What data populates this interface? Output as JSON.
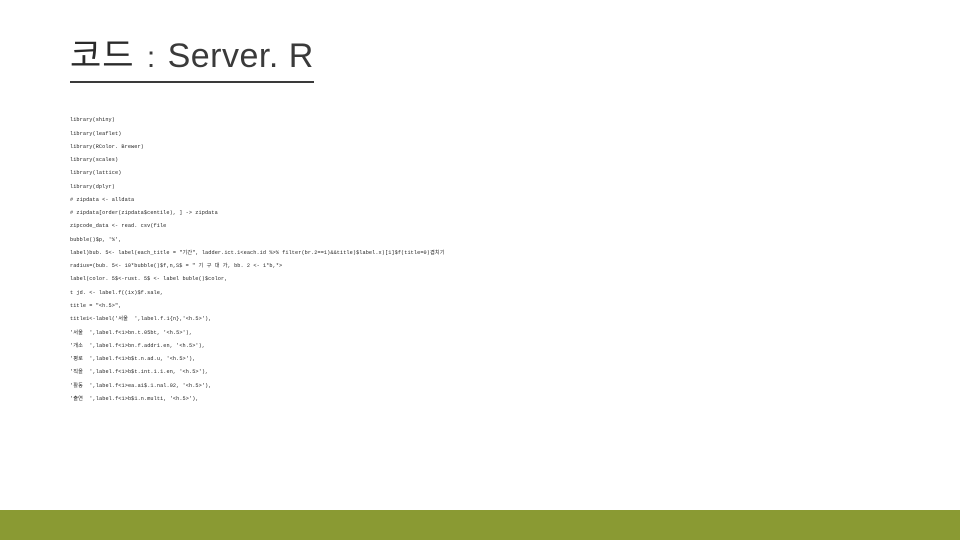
{
  "title": {
    "kr": "코드",
    "colon": " : ",
    "en": "Server. R"
  },
  "code": {
    "lines": [
      "library(shiny)",
      "library(leaflet)",
      "library(RColor. Brewer)",
      "library(scales)",
      "library(lattice)",
      "library(dplyr)",
      "# zipdata <- alldata",
      "# zipdata[order(zipdata$centile), ] -> zipdata",
      "zipcode_data <- read. csv(file",
      "bubble()$p, '%',",
      "label)bub. 5<- label(each_title = \"기간\", ladder.ict.1<each.id %>% filter(br.2==1)&&title)$label.x)[1]$f(title=0)겹치기",
      "radius=(bub. 5<- 10*bubble()$f,n,S$ = \" 기 구 대 가, bb. 2 <- 1*b,*>",
      "label(color. 5$<-rust. 5$ <- label buble()$color,",
      "t jd. <- label.f((ix)$f.sale,",
      "title = \"<h.5>\",",
      "title1<-label('서울  ',label.f.1{n},'<h.5>'),",
      "'서울  ',label.f<1>bn.t.05bt, '<h.5>'),",
      "'개소  ',label.f<1>bn.f.addr1.en, '<h.5>'),",
      "'평로  ',label.f<1>b$t.n.ad.u, '<h.5>'),",
      "'직을  ',label.f<1>b$t.int.1.1.en, '<h.5>'),",
      "'활동  ',label.f<1>ea.a1$.1.nal.02, '<h.5>'),",
      "'출연  ',label.f<1>b$1.n.multi, '<h.5>'),"
    ]
  }
}
